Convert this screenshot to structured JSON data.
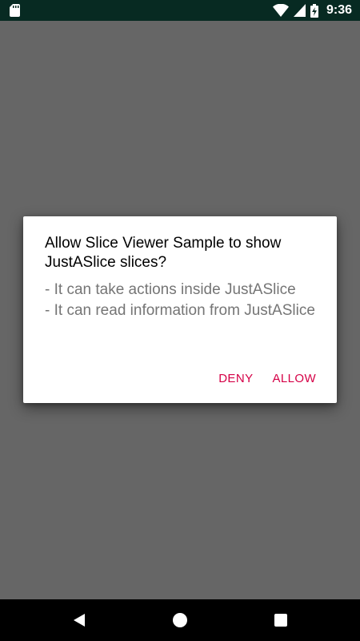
{
  "status_bar": {
    "time": "9:36",
    "icons": [
      "sd-card-icon",
      "wifi-icon",
      "signal-icon",
      "battery-charging-icon"
    ]
  },
  "dialog": {
    "title": "Allow Slice Viewer Sample to show JustASlice slices?",
    "lines": [
      "- It can take actions inside JustASlice",
      "- It can read information from JustASlice"
    ],
    "deny_label": "DENY",
    "allow_label": "ALLOW"
  },
  "nav_bar": {
    "icons": [
      "back-icon",
      "home-icon",
      "recents-icon"
    ]
  },
  "colors": {
    "status_bar_bg": "#072a22",
    "scrim": "#666666",
    "dialog_bg": "#ffffff",
    "accent": "#d50046",
    "body_text": "#757575",
    "nav_bar_bg": "#000000"
  }
}
